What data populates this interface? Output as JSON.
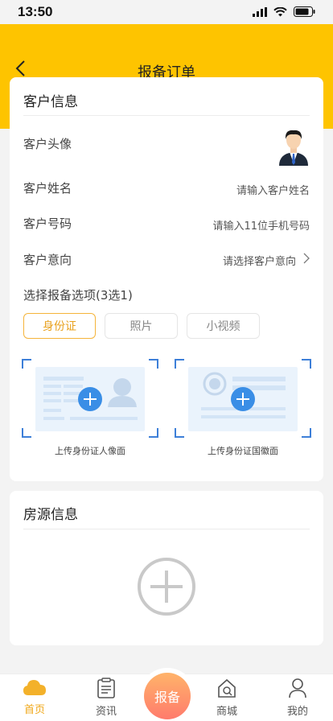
{
  "status": {
    "time": "13:50"
  },
  "header": {
    "title": "报备订单"
  },
  "customer": {
    "section_title": "客户信息",
    "avatar_label": "客户头像",
    "name_label": "客户姓名",
    "name_placeholder": "请输入客户姓名",
    "phone_label": "客户号码",
    "phone_placeholder": "请输入11位手机号码",
    "intent_label": "客户意向",
    "intent_placeholder": "请选择客户意向",
    "options_title": "选择报备选项(3选1)",
    "options": [
      "身份证",
      "照片",
      "小视频"
    ],
    "selected_option": "身份证",
    "upload_front": "上传身份证人像面",
    "upload_back": "上传身份证国徽面"
  },
  "property": {
    "section_title": "房源信息"
  },
  "tabbar": {
    "home": "首页",
    "news": "资讯",
    "report": "报备",
    "mall": "商城",
    "mine": "我的",
    "active": "首页"
  },
  "colors": {
    "brand_yellow": "#fec400",
    "accent_orange": "#f0a81b",
    "upload_blue": "#3d7fd8"
  }
}
